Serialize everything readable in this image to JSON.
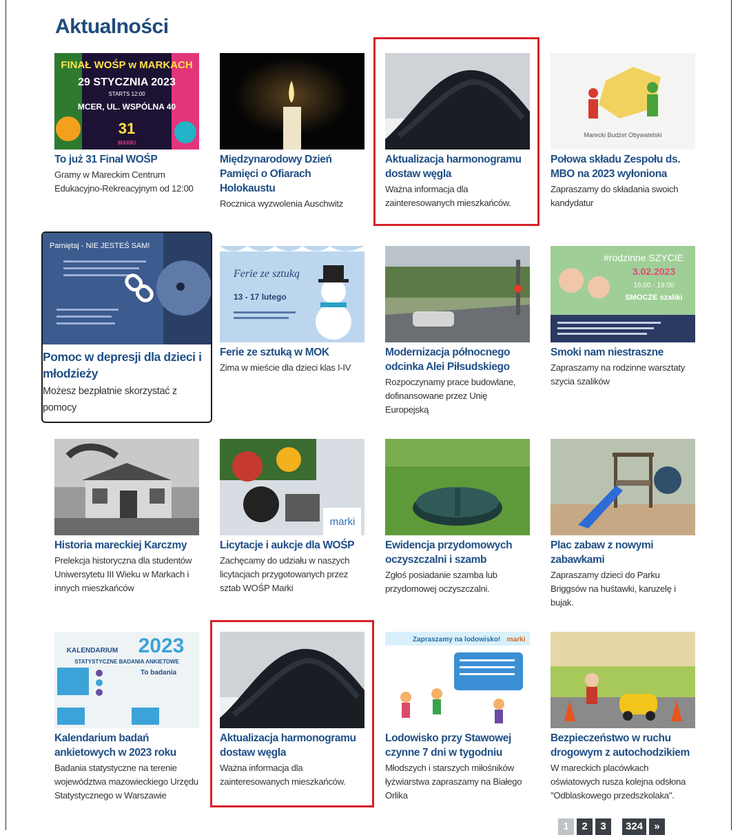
{
  "section": {
    "title": "Aktualności"
  },
  "news": [
    {
      "title": "To już 31 Finał WOŚP",
      "desc": "Gramy w Mareckim Centrum Edukacyjno-Rekreacyjnym od 12:00",
      "img": {
        "l1": "FINAŁ WOŚP w MARKACH",
        "l2": "29 STYCZNIA 2023",
        "l3": "STARTS 12:00",
        "l4": "MCER, UL. WSPÓLNA 40",
        "l5": "31",
        "l6": "MARKI"
      }
    },
    {
      "title": "Międzynarodowy Dzień Pamięci o Ofiarach Holokaustu",
      "desc": "Rocznica wyzwolenia Auschwitz"
    },
    {
      "title": "Aktualizacja harmonogramu dostaw węgla",
      "desc": "Ważna informacja dla zainteresowanych mieszkańców."
    },
    {
      "title": "Połowa składu Zespołu ds. MBO na 2023 wyłoniona",
      "desc": "Zapraszamy do składania swoich kandydatur",
      "img": {
        "l1": "Marecki Budżet Obywatelski"
      }
    },
    {
      "title": "Pomoc w depresji dla dzieci i młodzieży",
      "desc": "Możesz bezpłatnie skorzystać z pomocy",
      "img": {
        "l1": "Pamiętaj - NIE JESTEŚ SAM!"
      }
    },
    {
      "title": "Ferie ze sztuką w MOK",
      "desc": "Zima w mieście dla dzieci klas I-IV",
      "img": {
        "l1": "Ferie ze sztuką",
        "l2": "13 - 17 lutego"
      }
    },
    {
      "title": "Modernizacja północnego odcinka Alei Piłsudskiego",
      "desc": "Rozpoczynamy prace budowlane, dofinansowane przez Unię Europejską"
    },
    {
      "title": "Smoki nam niestraszne",
      "desc": "Zapraszamy na rodzinne warsztaty szycia szalików",
      "img": {
        "l1": "#rodzinne SZYCIE",
        "l2": "3.02.2023",
        "l3": "16:00 - 19:00",
        "l4": "SMOCZE szaliki"
      }
    },
    {
      "title": "Historia mareckiej Karczmy",
      "desc": "Prelekcja historyczna dla studentów Uniwersytetu III Wieku w Markach i innych mieszkańców"
    },
    {
      "title": "Licytacje i aukcje dla WOŚP",
      "desc": "Zachęcamy do udziału w naszych licytacjach przygotowanych przez sztab WOŚP Marki",
      "img": {
        "l1": "marki"
      }
    },
    {
      "title": "Ewidencja przydomowych oczyszczalni i szamb",
      "desc": "Zgłoś posiadanie szamba lub przydomowej oczyszczalni."
    },
    {
      "title": "Plac zabaw z nowymi zabawkami",
      "desc": "Zapraszamy dzieci do Parku Briggsów na huśtawki, karuzelę i bujak."
    },
    {
      "title": "Kalendarium badań ankietowych w 2023 roku",
      "desc": "Badania statystyczne na terenie województwa mazowieckiego Urzędu Statystycznego w Warszawie",
      "img": {
        "l1": "KALENDARIUM",
        "l2": "2023",
        "l3": "STATYSTYCZNE BADANIA ANKIETOWE",
        "l4": "To badania"
      }
    },
    {
      "title": "Aktualizacja harmonogramu dostaw węgla",
      "desc": "Ważna informacja dla zainteresowanych mieszkańców."
    },
    {
      "title": "Lodowisko przy Stawowej czynne 7 dni w tygodniu",
      "desc": "Młodszych i starszych miłośników łyżwiarstwa zapraszamy na Białego Orlika",
      "img": {
        "l1": "Zapraszamy na lodowisko!",
        "l2": "marki"
      }
    },
    {
      "title": "Bezpieczeństwo w ruchu drogowym z autochodzikiem",
      "desc": "W mareckich placówkach oświatowych rusza kolejna odsłona \"Odblaskowego przedszkolaka\"."
    }
  ],
  "pagination": {
    "p1": "1",
    "p2": "2",
    "p3": "3",
    "last": "324",
    "next": "»"
  }
}
